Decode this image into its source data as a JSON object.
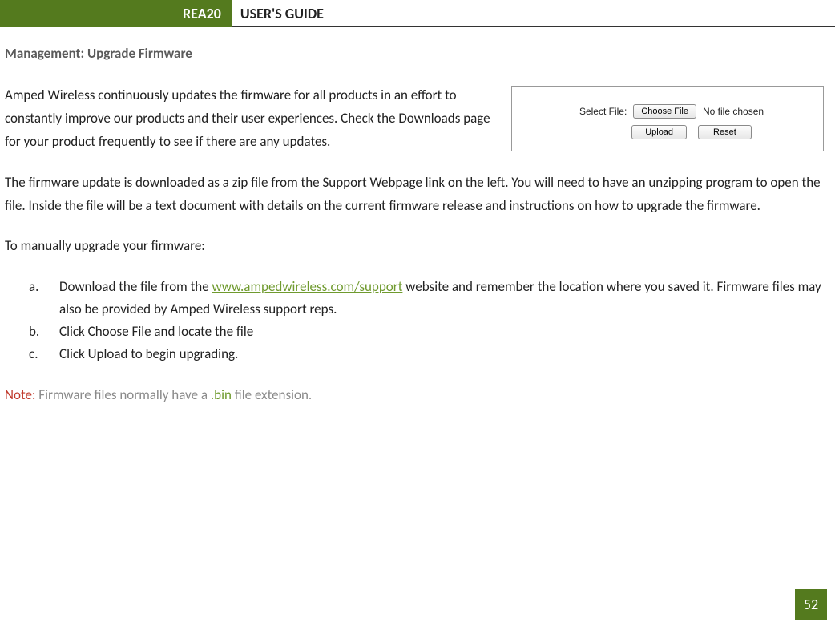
{
  "header": {
    "badge": "REA20",
    "title": "USER'S GUIDE"
  },
  "section_title": "Management: Upgrade Firmware",
  "intro": "Amped Wireless continuously updates the firmware for all products in an effort to constantly improve our products and their user experiences. Check the Downloads page for your product frequently to see if there are any updates.",
  "panel": {
    "label": "Select File:",
    "choose": "Choose File",
    "status": "No file chosen",
    "upload": "Upload",
    "reset": "Reset"
  },
  "para2": "The firmware update is downloaded as a zip file from the Support Webpage link on the left. You will need to have an unzipping program to open the file. Inside the file will be a text document with details on the current firmware release and instructions on how to upgrade the firmware.",
  "para3": "To manually upgrade your firmware:",
  "steps": {
    "a": {
      "marker": "a.",
      "pre": "Download the file from the ",
      "link": "www.ampedwireless.com/support",
      "post": " website and remember the location where you saved it. Firmware files may also be provided by Amped Wireless support reps."
    },
    "b": {
      "marker": "b.",
      "text": "Click Choose File and locate the file"
    },
    "c": {
      "marker": "c.",
      "text": "Click Upload to begin upgrading."
    }
  },
  "note": {
    "label": "Note:",
    "pre": " Firmware files normally have a ",
    "ext": ".bin",
    "post": " file extension."
  },
  "page_number": "52"
}
